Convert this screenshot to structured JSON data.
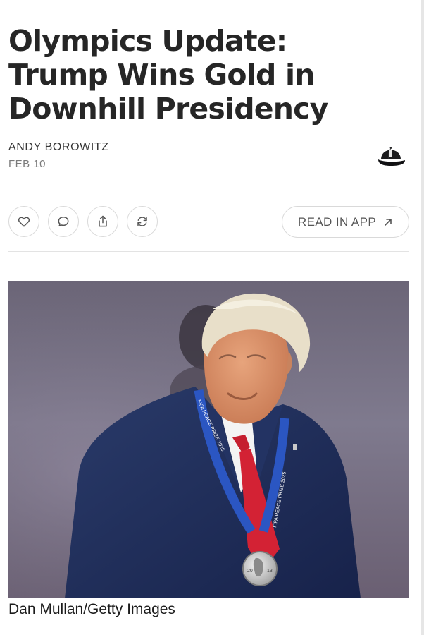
{
  "article": {
    "headline_line1": "Olympics Update:",
    "headline_line2": "Trump Wins Gold in",
    "headline_line3": "Downhill Presidency",
    "author": "ANDY BOROWITZ",
    "date": "FEB 10",
    "photo_credit": "Dan Mullan/Getty Images"
  },
  "actions": {
    "like_icon": "heart-icon",
    "comment_icon": "comment-bubble-icon",
    "share_icon": "share-upload-icon",
    "restack_icon": "refresh-icon",
    "read_in_app_label": "READ IN APP",
    "read_in_app_icon": "arrow-up-right-icon"
  },
  "photo": {
    "ribbon_text": "FIFA PEACE PRIZE 2025",
    "medal_text_left": "20",
    "medal_text_right": "13"
  },
  "colors": {
    "headline": "#262626",
    "suit": "#1f2d55",
    "tie": "#d32234",
    "ribbon": "#2b56c2",
    "background_photo": "#6f6a80"
  }
}
